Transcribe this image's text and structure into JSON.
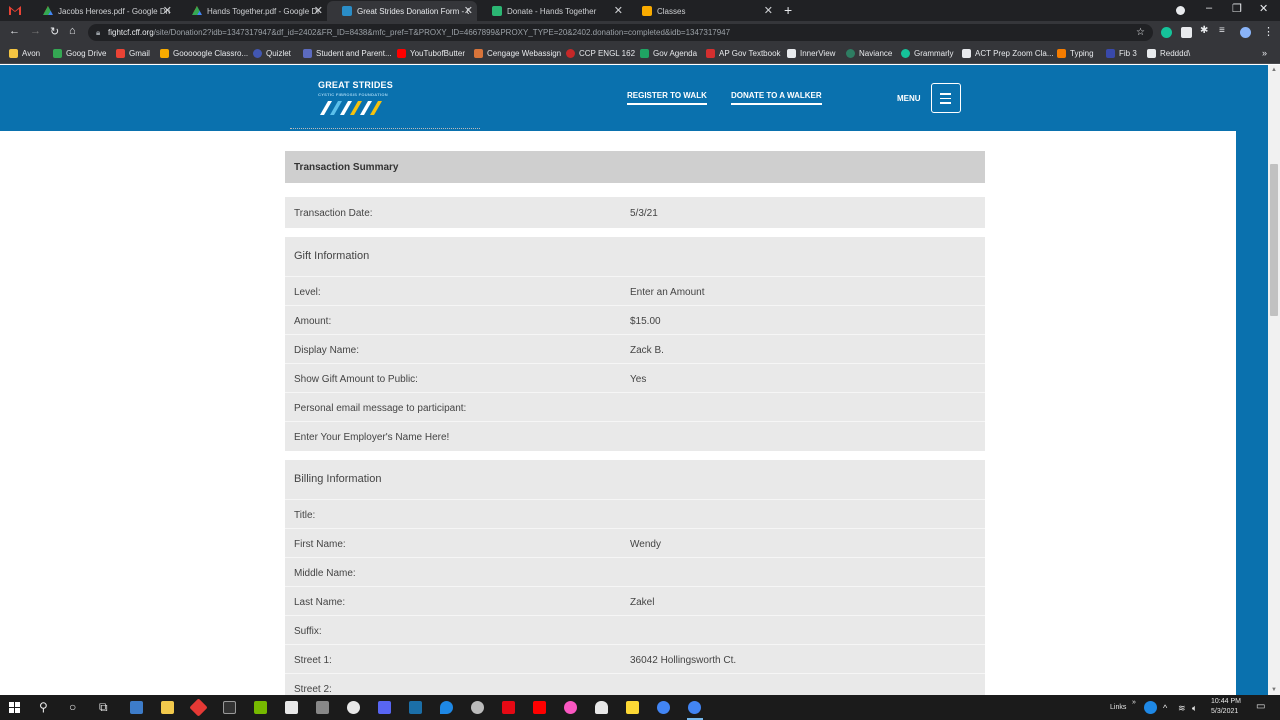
{
  "browser": {
    "tabs": [
      {
        "title": "Jacobs Heroes.pdf - Google Driv",
        "icon": "google-drive-icon"
      },
      {
        "title": "Hands Together.pdf - Google Dr",
        "icon": "google-drive-icon"
      },
      {
        "title": "Great Strides Donation Form - Cy",
        "icon": "great-strides-icon"
      },
      {
        "title": "Donate - Hands Together",
        "icon": "hands-together-icon"
      },
      {
        "title": "Classes",
        "icon": "classes-icon"
      }
    ],
    "url_host": "fightcf.cff.org",
    "url_path": "/site/Donation2?idb=1347317947&df_id=2402&FR_ID=8438&mfc_pref=T&PROXY_ID=4667899&PROXY_TYPE=20&2402.donation=completed&idb=1347317947",
    "bookmarks": [
      "Avon",
      "Goog Drive",
      "Gmail",
      "Gooooogle Classro...",
      "Quizlet",
      "Student and Parent...",
      "YouTubofButter",
      "Cengage Webassign",
      "CCP ENGL 162",
      "Gov Agenda",
      "AP Gov Textbook",
      "InnerView",
      "Naviance",
      "Grammarly",
      "ACT Prep Zoom Cla...",
      "Typing",
      "Fib 3",
      "Redddd\\"
    ]
  },
  "site": {
    "logo_title": "GREAT STRIDES",
    "logo_subtitle": "CYSTIC FIBROSIS FOUNDATION",
    "nav": {
      "register": "REGISTER TO WALK",
      "donate": "DONATE TO A WALKER",
      "menu": "MENU"
    },
    "colors": {
      "brand": "#0a71ae"
    }
  },
  "summary": {
    "title": "Transaction Summary",
    "date_label": "Transaction Date:",
    "date_value": "5/3/21"
  },
  "gift": {
    "title": "Gift Information",
    "rows": [
      {
        "label": "Level:",
        "value": "Enter an Amount"
      },
      {
        "label": "Amount:",
        "value": "$15.00"
      },
      {
        "label": "Display Name:",
        "value": "Zack B."
      },
      {
        "label": "Show Gift Amount to Public:",
        "value": "Yes"
      },
      {
        "label": "Personal email message to participant:",
        "value": ""
      },
      {
        "label": "Enter Your Employer's Name Here!",
        "value": ""
      }
    ]
  },
  "billing": {
    "title": "Billing Information",
    "rows": [
      {
        "label": "Title:",
        "value": ""
      },
      {
        "label": "First Name:",
        "value": "Wendy"
      },
      {
        "label": "Middle Name:",
        "value": ""
      },
      {
        "label": "Last Name:",
        "value": "Zakel"
      },
      {
        "label": "Suffix:",
        "value": ""
      },
      {
        "label": "Street 1:",
        "value": "36042 Hollingsworth Ct."
      },
      {
        "label": "Street 2:",
        "value": ""
      }
    ]
  },
  "taskbar": {
    "links": "Links",
    "time": "10:44 PM",
    "date": "5/3/2021"
  }
}
